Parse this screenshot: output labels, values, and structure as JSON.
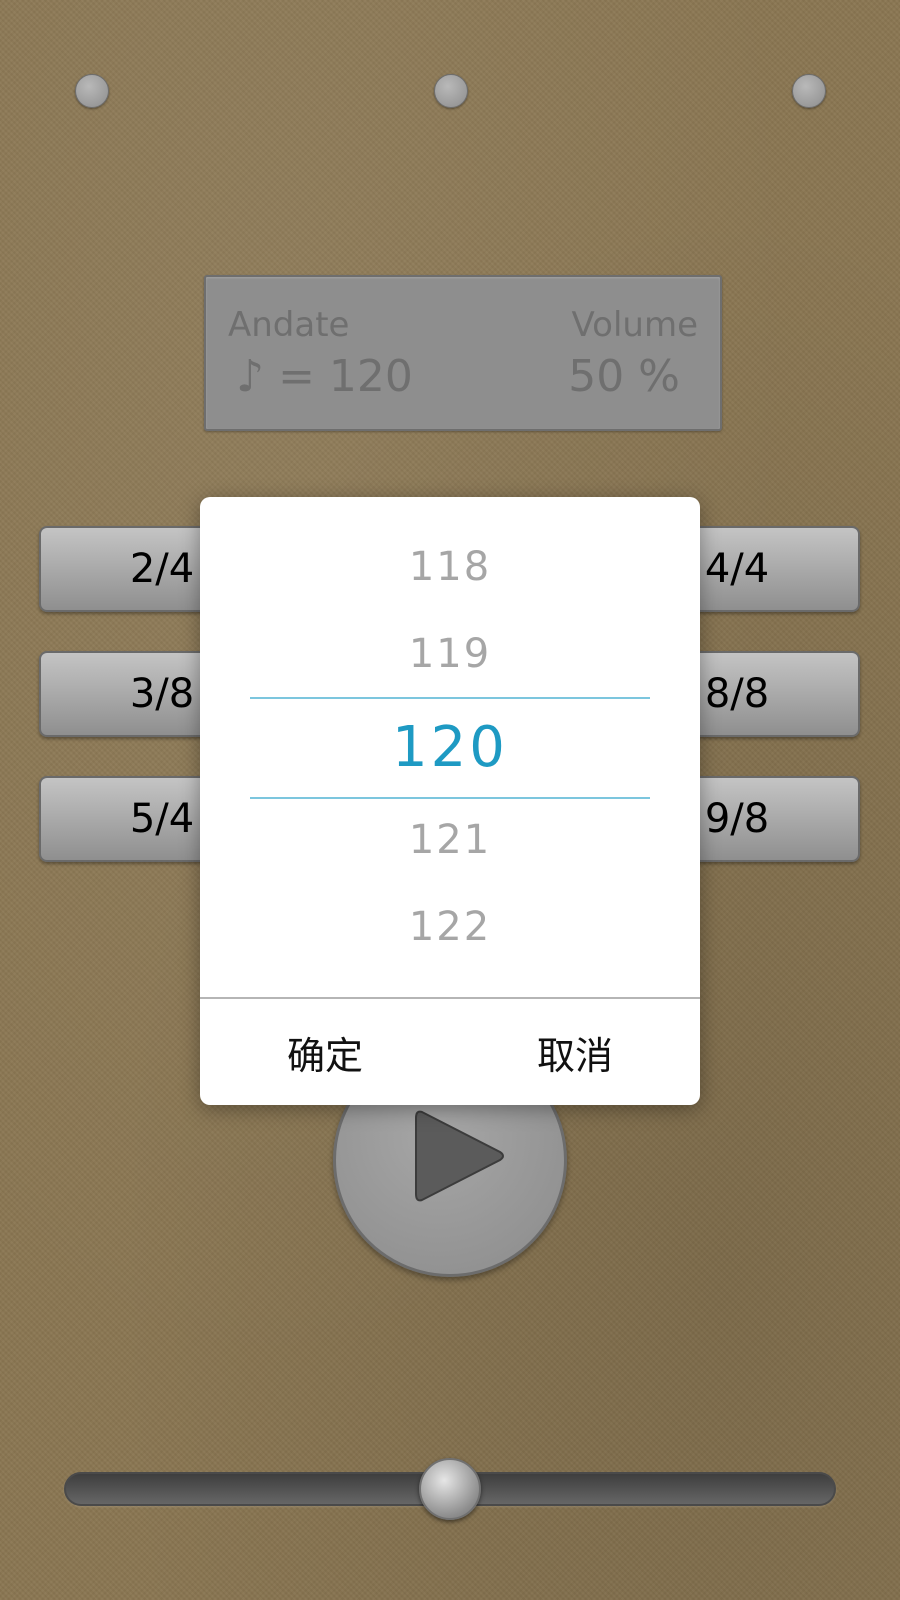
{
  "info": {
    "tempo_name": "Andate",
    "tempo_value": "♪ = 120",
    "volume_label": "Volume",
    "volume_value": "50 %"
  },
  "time_signatures": {
    "left": [
      "2/4",
      "3/8",
      "5/4"
    ],
    "right": [
      "4/4",
      "8/8",
      "9/8"
    ]
  },
  "picker": {
    "items": [
      "118",
      "119",
      "120",
      "121",
      "122"
    ],
    "selected": "120"
  },
  "dialog": {
    "confirm_label": "确定",
    "cancel_label": "取消"
  },
  "slider": {
    "level": 0.5
  },
  "colors": {
    "background": "#8a7652",
    "accent": "#1e9ac3",
    "picker_line": "#7cc6de"
  },
  "icons": {
    "play": "play-icon",
    "beat_indicator": "beat-dot"
  }
}
